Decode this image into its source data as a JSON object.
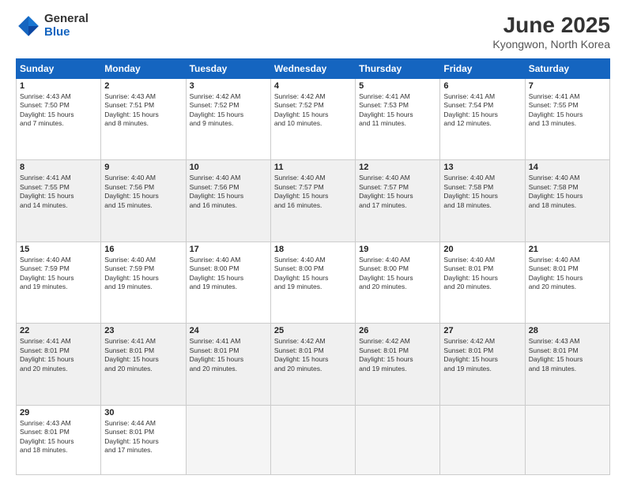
{
  "header": {
    "logo_general": "General",
    "logo_blue": "Blue",
    "month": "June 2025",
    "location": "Kyongwon, North Korea"
  },
  "days_of_week": [
    "Sunday",
    "Monday",
    "Tuesday",
    "Wednesday",
    "Thursday",
    "Friday",
    "Saturday"
  ],
  "weeks": [
    [
      {
        "day": 1,
        "info": "Sunrise: 4:43 AM\nSunset: 7:50 PM\nDaylight: 15 hours\nand 7 minutes."
      },
      {
        "day": 2,
        "info": "Sunrise: 4:43 AM\nSunset: 7:51 PM\nDaylight: 15 hours\nand 8 minutes."
      },
      {
        "day": 3,
        "info": "Sunrise: 4:42 AM\nSunset: 7:52 PM\nDaylight: 15 hours\nand 9 minutes."
      },
      {
        "day": 4,
        "info": "Sunrise: 4:42 AM\nSunset: 7:52 PM\nDaylight: 15 hours\nand 10 minutes."
      },
      {
        "day": 5,
        "info": "Sunrise: 4:41 AM\nSunset: 7:53 PM\nDaylight: 15 hours\nand 11 minutes."
      },
      {
        "day": 6,
        "info": "Sunrise: 4:41 AM\nSunset: 7:54 PM\nDaylight: 15 hours\nand 12 minutes."
      },
      {
        "day": 7,
        "info": "Sunrise: 4:41 AM\nSunset: 7:55 PM\nDaylight: 15 hours\nand 13 minutes."
      }
    ],
    [
      {
        "day": 8,
        "info": "Sunrise: 4:41 AM\nSunset: 7:55 PM\nDaylight: 15 hours\nand 14 minutes."
      },
      {
        "day": 9,
        "info": "Sunrise: 4:40 AM\nSunset: 7:56 PM\nDaylight: 15 hours\nand 15 minutes."
      },
      {
        "day": 10,
        "info": "Sunrise: 4:40 AM\nSunset: 7:56 PM\nDaylight: 15 hours\nand 16 minutes."
      },
      {
        "day": 11,
        "info": "Sunrise: 4:40 AM\nSunset: 7:57 PM\nDaylight: 15 hours\nand 16 minutes."
      },
      {
        "day": 12,
        "info": "Sunrise: 4:40 AM\nSunset: 7:57 PM\nDaylight: 15 hours\nand 17 minutes."
      },
      {
        "day": 13,
        "info": "Sunrise: 4:40 AM\nSunset: 7:58 PM\nDaylight: 15 hours\nand 18 minutes."
      },
      {
        "day": 14,
        "info": "Sunrise: 4:40 AM\nSunset: 7:58 PM\nDaylight: 15 hours\nand 18 minutes."
      }
    ],
    [
      {
        "day": 15,
        "info": "Sunrise: 4:40 AM\nSunset: 7:59 PM\nDaylight: 15 hours\nand 19 minutes."
      },
      {
        "day": 16,
        "info": "Sunrise: 4:40 AM\nSunset: 7:59 PM\nDaylight: 15 hours\nand 19 minutes."
      },
      {
        "day": 17,
        "info": "Sunrise: 4:40 AM\nSunset: 8:00 PM\nDaylight: 15 hours\nand 19 minutes."
      },
      {
        "day": 18,
        "info": "Sunrise: 4:40 AM\nSunset: 8:00 PM\nDaylight: 15 hours\nand 19 minutes."
      },
      {
        "day": 19,
        "info": "Sunrise: 4:40 AM\nSunset: 8:00 PM\nDaylight: 15 hours\nand 20 minutes."
      },
      {
        "day": 20,
        "info": "Sunrise: 4:40 AM\nSunset: 8:01 PM\nDaylight: 15 hours\nand 20 minutes."
      },
      {
        "day": 21,
        "info": "Sunrise: 4:40 AM\nSunset: 8:01 PM\nDaylight: 15 hours\nand 20 minutes."
      }
    ],
    [
      {
        "day": 22,
        "info": "Sunrise: 4:41 AM\nSunset: 8:01 PM\nDaylight: 15 hours\nand 20 minutes."
      },
      {
        "day": 23,
        "info": "Sunrise: 4:41 AM\nSunset: 8:01 PM\nDaylight: 15 hours\nand 20 minutes."
      },
      {
        "day": 24,
        "info": "Sunrise: 4:41 AM\nSunset: 8:01 PM\nDaylight: 15 hours\nand 20 minutes."
      },
      {
        "day": 25,
        "info": "Sunrise: 4:42 AM\nSunset: 8:01 PM\nDaylight: 15 hours\nand 20 minutes."
      },
      {
        "day": 26,
        "info": "Sunrise: 4:42 AM\nSunset: 8:01 PM\nDaylight: 15 hours\nand 19 minutes."
      },
      {
        "day": 27,
        "info": "Sunrise: 4:42 AM\nSunset: 8:01 PM\nDaylight: 15 hours\nand 19 minutes."
      },
      {
        "day": 28,
        "info": "Sunrise: 4:43 AM\nSunset: 8:01 PM\nDaylight: 15 hours\nand 18 minutes."
      }
    ],
    [
      {
        "day": 29,
        "info": "Sunrise: 4:43 AM\nSunset: 8:01 PM\nDaylight: 15 hours\nand 18 minutes."
      },
      {
        "day": 30,
        "info": "Sunrise: 4:44 AM\nSunset: 8:01 PM\nDaylight: 15 hours\nand 17 minutes."
      },
      null,
      null,
      null,
      null,
      null
    ]
  ]
}
